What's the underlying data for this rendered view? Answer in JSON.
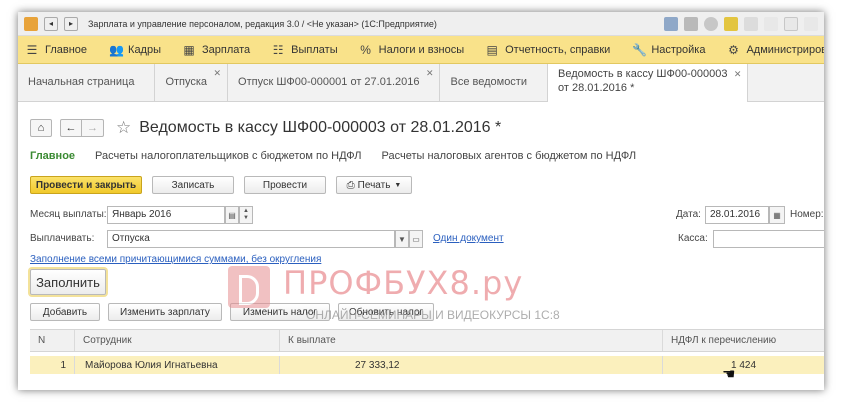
{
  "window": {
    "title": "Зарплата и управление персоналом, редакция 3.0 / <Не указан> (1С:Предприятие)"
  },
  "menu": [
    {
      "label": "Главное",
      "icon": "hamburger-menu-icon",
      "glyph": "☰"
    },
    {
      "label": "Кадры",
      "icon": "people-icon",
      "glyph": "👥"
    },
    {
      "label": "Зарплата",
      "icon": "calculator-icon",
      "glyph": "▦"
    },
    {
      "label": "Выплаты",
      "icon": "cash-icon",
      "glyph": "☷"
    },
    {
      "label": "Налоги и взносы",
      "icon": "percent-icon",
      "glyph": "%"
    },
    {
      "label": "Отчетность, справки",
      "icon": "report-icon",
      "glyph": "▤"
    },
    {
      "label": "Настройка",
      "icon": "wrench-icon",
      "glyph": "🔧"
    },
    {
      "label": "Администрирование",
      "icon": "gear-icon",
      "glyph": "⚙"
    }
  ],
  "tabs": [
    {
      "label": "Начальная страница",
      "closable": false
    },
    {
      "label": "Отпуска",
      "closable": true
    },
    {
      "label": "Отпуск ШФ00-000001 от 27.01.2016",
      "closable": true
    },
    {
      "label": "Все ведомости",
      "closable": false
    },
    {
      "label_line1": "Ведомость в кассу ШФ00-000003",
      "label_line2": "от 28.01.2016 *",
      "closable": true
    }
  ],
  "document": {
    "title": "Ведомость в кассу ШФ00-000003 от 28.01.2016 *",
    "subnav": [
      "Главное",
      "Расчеты налогоплательщиков с бюджетом по НДФЛ",
      "Расчеты налоговых агентов с бюджетом по НДФЛ"
    ]
  },
  "toolbar": {
    "post_close": "Провести и закрыть",
    "save": "Записать",
    "post": "Провести",
    "print": "Печать"
  },
  "fields": {
    "month_label": "Месяц выплаты:",
    "month_value": "Январь 2016",
    "pay_label": "Выплачивать:",
    "pay_value": "Отпуска",
    "one_doc_link": "Один документ",
    "date_label": "Дата:",
    "date_value": "28.01.2016",
    "number_label": "Номер:",
    "cash_label": "Касса:",
    "fill_link": "Заполнение всеми причитающимися суммами, без округления"
  },
  "fill_button": "Заполнить",
  "actions": [
    "Добавить",
    "Изменить зарплату",
    "Изменить налог",
    "Обновить налог"
  ],
  "table": {
    "columns": [
      "N",
      "Сотрудник",
      "К выплате",
      "НДФЛ к перечислению"
    ],
    "rows": [
      {
        "n": "1",
        "employee": "Майорова Юлия Игнатьевна",
        "amount": "27 333,12",
        "tax": "1 424"
      }
    ]
  },
  "watermark": {
    "main": "ПРОФБУХ8.ру",
    "sub": "ОНЛАЙН-СЕМИНАРЫ И ВИДЕОКУРСЫ 1С:8"
  },
  "colors": {
    "menu_bg": "#f9e28a",
    "primary_button": "#f1c92b",
    "selected_row": "#fbf0bd",
    "active_subnav": "#3a8a32",
    "link": "#2a5fbf"
  }
}
